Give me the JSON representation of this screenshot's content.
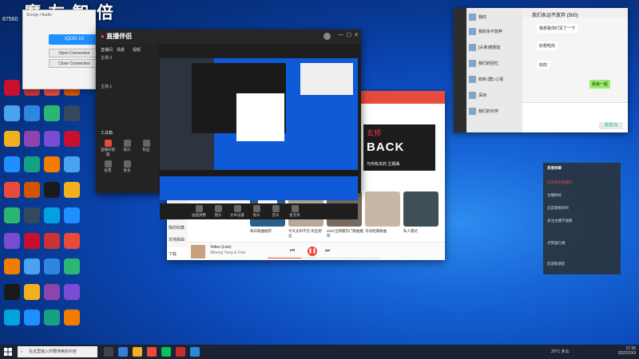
{
  "overlay": {
    "logo_text": "魔 左 智 倍",
    "number": "87560"
  },
  "conn_win": {
    "title": "Scrcpy / Audio",
    "device": "iQOO 10",
    "open_btn": "Open Connection",
    "close_btn": "Close Connection"
  },
  "live_app": {
    "brand": "直播伴侣",
    "tabs": [
      "直播间",
      "场景",
      "视频"
    ],
    "scenes": [
      "主场 2",
      "主场 1"
    ],
    "panel_title": "工具箱",
    "tools": [
      "直播间管理",
      "观众",
      "粉丝",
      "投票",
      "更多"
    ],
    "bottom_tools": [
      "画面调整",
      "镜头",
      "文本设置",
      "观众",
      "音乐",
      "麦克风"
    ],
    "colors": {
      "accent": "#e84b3a"
    }
  },
  "music_app": {
    "banner_title": "玄师",
    "banner_big": "BACK",
    "banner_sub": "与你有关的 主题曲",
    "sidebar": [
      "推荐",
      "我的歌单",
      "我的收藏",
      "本地歌曲",
      "下载"
    ],
    "cards": [
      {
        "caption": "每日歌曲推荐"
      },
      {
        "caption": "今天太阳不见 有些想念"
      },
      {
        "caption": "2022全网最热门歌曲推荐"
      },
      {
        "caption": "华语经典歌曲"
      },
      {
        "caption": "私人雷达"
      }
    ],
    "player": {
      "song": "Video (Live)",
      "artist": "Mikeng Yang & Fow"
    },
    "colors": {
      "accent": "#e84b3a"
    }
  },
  "chat_win": {
    "title": "我们永远不放弃 (500)",
    "list": [
      "我的",
      "我的永不放弃",
      "[头条]老朋友",
      "我们的回忆",
      "收到 (群) 心情",
      "深圳",
      "我们的伙伴"
    ],
    "messages": [
      "我想看你们写了一下",
      "好想吃的",
      "好的",
      "我来一起"
    ],
    "send": "发送(S)"
  },
  "dark_panel": {
    "header": "直播弹幕",
    "lines": [
      "欢迎来到直播间",
      "主播你好",
      "这首歌很好听",
      "关注主播不迷路",
      "点赞送礼物",
      "欢迎新朋友"
    ]
  },
  "taskbar": {
    "search_placeholder": "在这里输入你要搜索的内容",
    "weather": "20°C 多云",
    "time": "17:36",
    "date": "2022/10/3"
  }
}
